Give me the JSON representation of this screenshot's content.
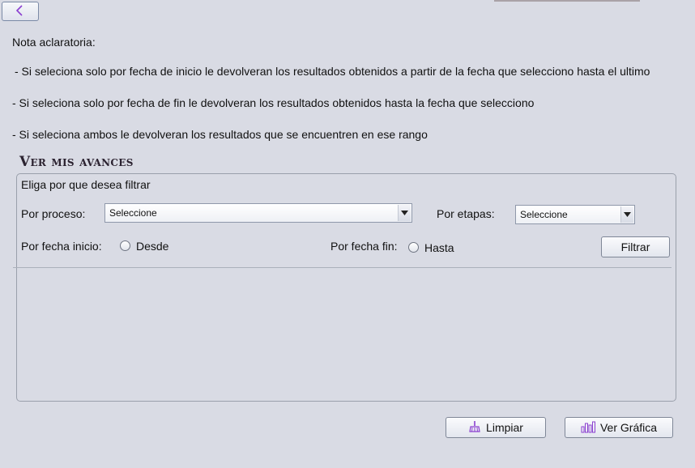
{
  "header": {
    "back_icon": "chevron-left-icon"
  },
  "notes": {
    "title": "Nota aclaratoria:",
    "line1": "- Si seleciona solo por fecha de inicio le devolveran los resultados obtenidos a partir de la fecha que selecciono hasta el ultimo",
    "line2": "- Si seleciona solo por fecha de fin le devolveran los resultados obtenidos hasta la fecha que selecciono",
    "line3": "- Si seleciona ambos le devolveran los resultados que se encuentren en ese rango"
  },
  "section": {
    "title": "Ver mis avances"
  },
  "filter": {
    "hint": "Eliga por que desea filtrar",
    "proceso_label": "Por proceso:",
    "proceso_value": "Seleccione",
    "etapas_label": "Por etapas:",
    "etapas_value": "Seleccione",
    "fecha_inicio_label": "Por fecha inicio:",
    "desde_label": "Desde",
    "fecha_fin_label": "Por fecha fin:",
    "hasta_label": "Hasta",
    "filtrar_label": "Filtrar"
  },
  "actions": {
    "limpiar_label": "Limpiar",
    "limpiar_icon": "broom-icon",
    "grafica_label": "Ver Gráfica",
    "grafica_icon": "bar-chart-icon"
  },
  "colors": {
    "accent_icon": "#8a3fd0",
    "background": "#d9dbe4"
  }
}
